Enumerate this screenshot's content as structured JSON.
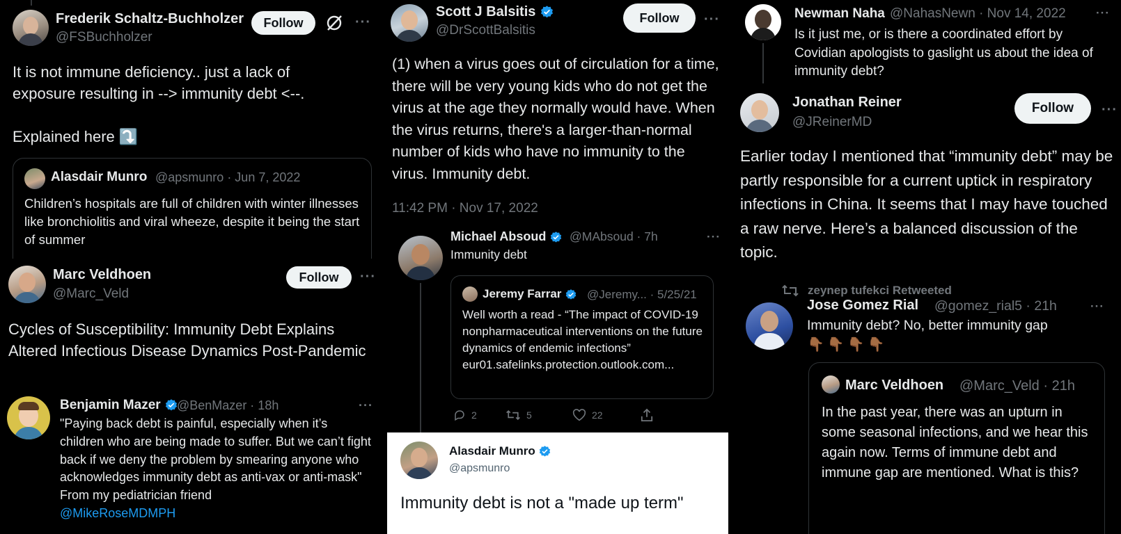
{
  "panels": {
    "frederik": {
      "name": "Frederik Schaltz-Buchholzer",
      "handle": "@FSBuchholzer",
      "follow": "Follow",
      "more": "···",
      "body_line1": "It is not immune deficiency.. just a lack of",
      "body_line2": "exposure resulting in --> immunity debt <--.",
      "body_line3": "Explained here ⤵️",
      "quote": {
        "name": "Alasdair Munro",
        "meta": "@apsmunro · Jun 7, 2022",
        "text": "Children’s hospitals are full of children with winter illnesses like bronchiolitis and viral wheeze, despite it being the start of summer"
      }
    },
    "marc_top": {
      "name": "Marc Veldhoen",
      "handle": "@Marc_Veld",
      "follow": "Follow",
      "more": "···",
      "body": "Cycles of Susceptibility: Immunity Debt Explains Altered Infectious Disease Dynamics Post-Pandemic"
    },
    "benjamin": {
      "name": "Benjamin Mazer",
      "meta": "@BenMazer · 18h",
      "more": "···",
      "body": "\"Paying back debt is painful, especially when it’s children who are being made to suffer. But we can’t fight back if we deny the problem by smearing anyone who acknowledges immunity debt as anti-vax or anti-mask\" From my pediatrician friend",
      "mention": "@MikeRoseMDMPH"
    },
    "scott": {
      "name": "Scott J Balsitis",
      "handle": "@DrScottBalsitis",
      "follow": "Follow",
      "more": "···",
      "body": "(1) when a virus goes out of circulation for a time, there will be very young kids who do not get the virus at the age they normally would have.  When the virus returns, there's a larger-than-normal number of kids who have no immunity to the virus.  Immunity debt.",
      "timestamp": "11:42 PM · Nov 17, 2022"
    },
    "michael": {
      "name": "Michael Absoud",
      "meta": "@MAbsoud · 7h",
      "more": "···",
      "body": "Immunity debt",
      "quote": {
        "name": "Jeremy Farrar",
        "meta": "@Jeremy... · 5/25/21",
        "text": "Well worth a read - “The impact of COVID-19 nonpharmaceutical interventions on the future dynamics of endemic infections” eur01.safelinks.protection.outlook.com..."
      },
      "actions": {
        "replies": "2",
        "retweets": "5",
        "likes": "22"
      }
    },
    "alasdair_light": {
      "name": "Alasdair Munro",
      "handle": "@apsmunro",
      "body": "Immunity debt is not a \"made up term\""
    },
    "newman": {
      "name": "Newman Naha",
      "meta": "@NahasNewn · Nov 14, 2022",
      "more": "···",
      "body": "Is it just me, or is there a coordinated effort by Covidian apologists to gaslight us about the idea of immunity debt?"
    },
    "jonathan": {
      "name": "Jonathan Reiner",
      "handle": "@JReinerMD",
      "follow": "Follow",
      "more": "···",
      "body": "Earlier today I mentioned that “immunity debt” may be partly responsible for a current uptick in respiratory infections in China. It seems that I may have touched a raw nerve. Here’s a balanced discussion of the topic."
    },
    "jose": {
      "retweeted_by": "zeynep tufekci Retweeted",
      "name": "Jose Gomez Rial",
      "meta": "@gomez_rial5 · 21h",
      "more": "···",
      "body": "Immunity debt? No, better immunity gap",
      "emoji": "👇🏾👇🏾👇🏾👇🏾",
      "quote": {
        "name": "Marc Veldhoen",
        "meta": "@Marc_Veld · 21h",
        "text": "In the past year, there was an upturn in some seasonal infections, and we hear this again now. Terms of immune debt and immune gap are mentioned. What is this?"
      }
    }
  },
  "colors": {
    "background": "#000000",
    "text": "#e7e9ea",
    "muted": "#71767b",
    "verified": "#1d9bf0",
    "link": "#1d9bf0",
    "follow_bg": "#eff3f4",
    "light_panel_bg": "#ffffff"
  }
}
